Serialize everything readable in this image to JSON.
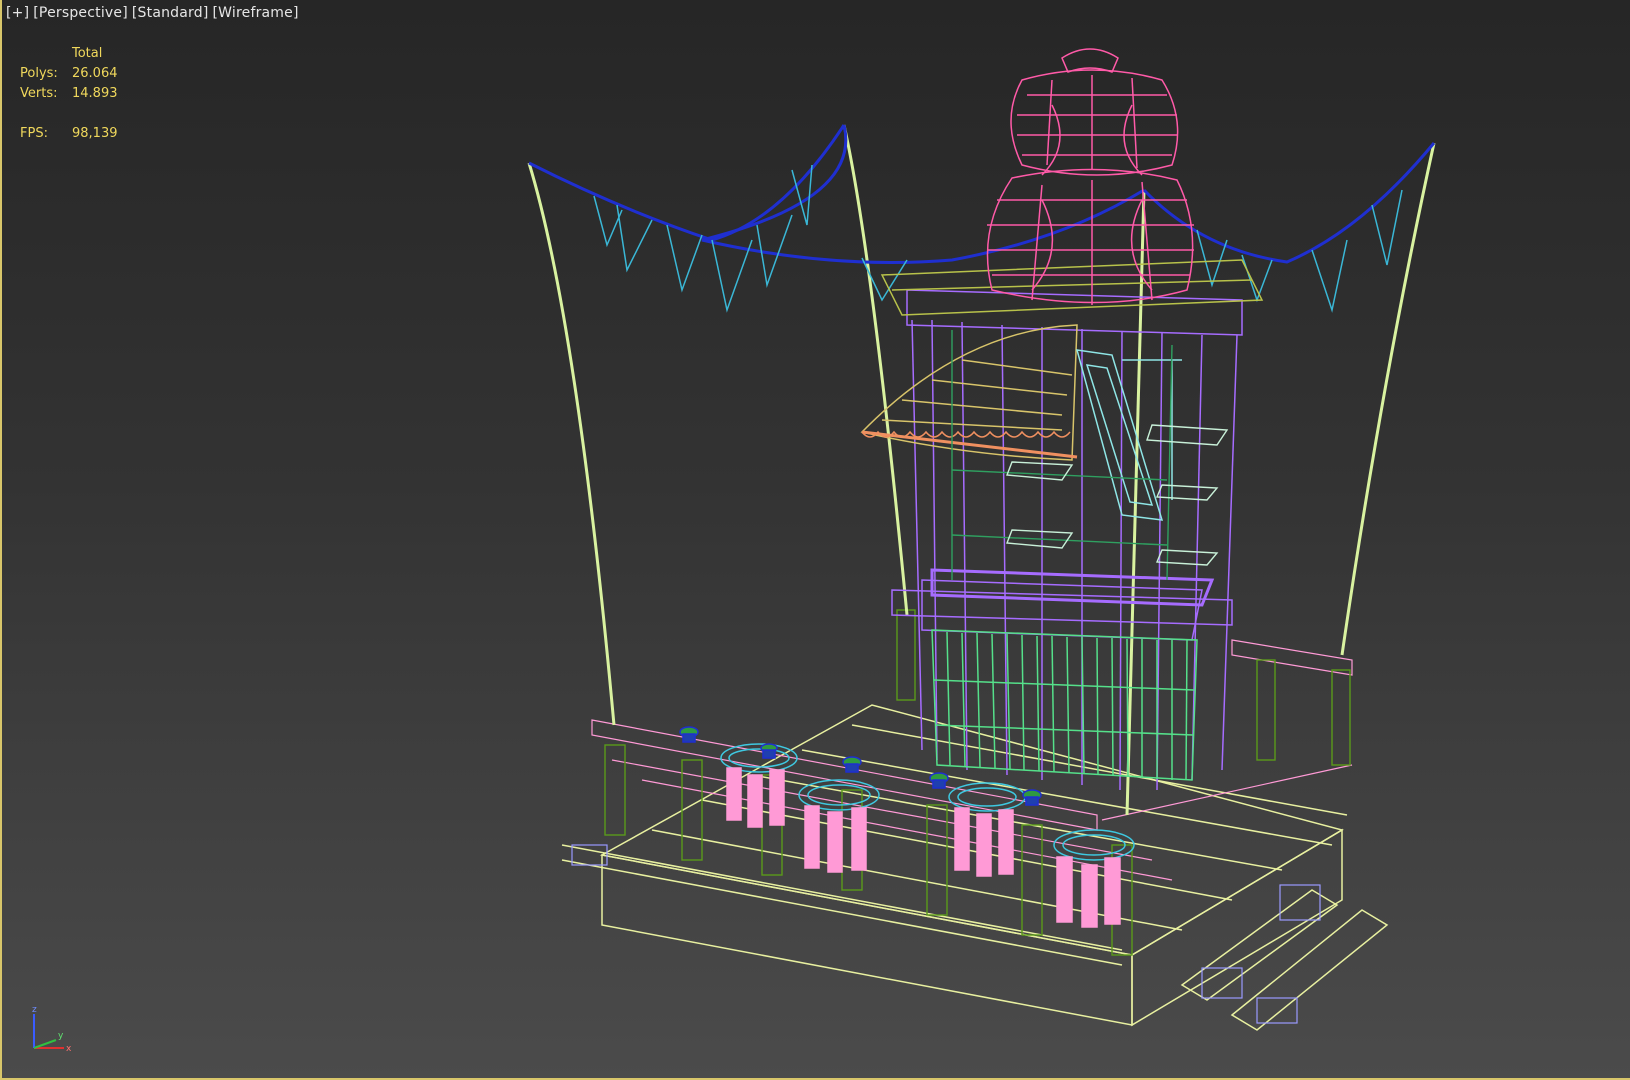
{
  "viewport": {
    "labels": [
      "[+]",
      "[Perspective]",
      "[Standard]",
      "[Wireframe]"
    ],
    "stats": {
      "header": "Total",
      "polys_label": "Polys:",
      "polys_value": "26.064",
      "verts_label": "Verts:",
      "verts_value": "14.893",
      "fps_label": "FPS:",
      "fps_value": "98,139"
    },
    "axis": {
      "x": "x",
      "y": "y",
      "z": "z"
    }
  },
  "colors": {
    "border": "#d8c66a",
    "stats_text": "#f0d85c",
    "pole": "#d9f2a0",
    "bunting": "#1f2fd0",
    "flags": "#3ab7d6",
    "lantern": "#ff5aa8",
    "frame": "#a66cff",
    "basket": "#55e08a",
    "stool_seat": "#3ec8e0",
    "stool_leg": "#ff9ad6",
    "deck": "#e8f0a0",
    "green_post": "#5a9a1a",
    "awning": "#f09060"
  }
}
